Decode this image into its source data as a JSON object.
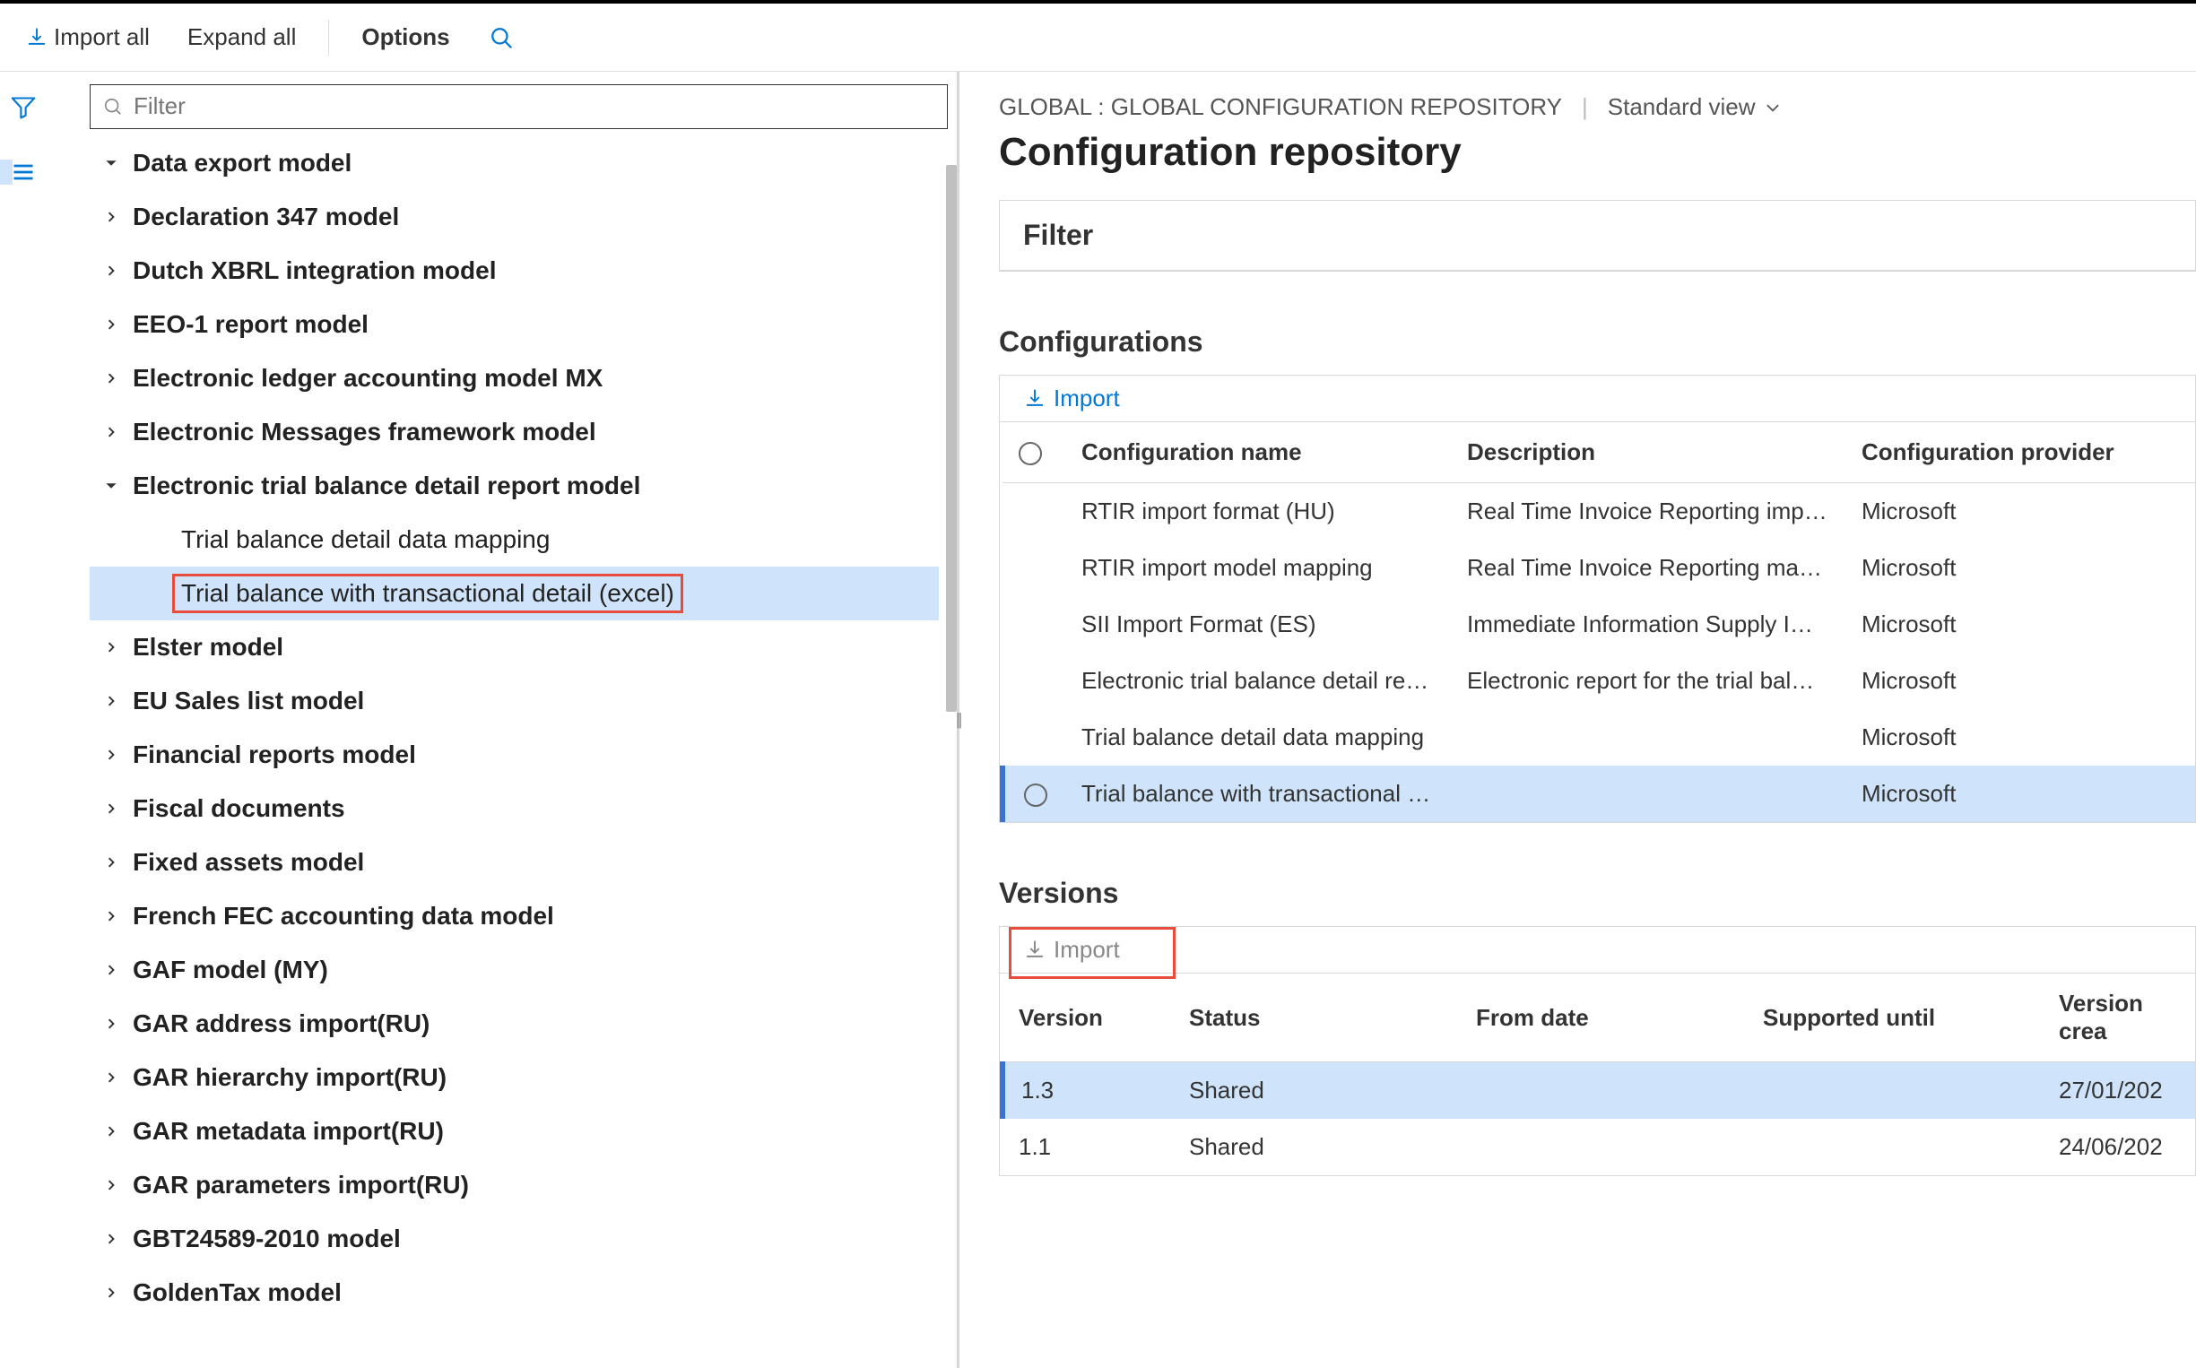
{
  "toolbar": {
    "import_all": "Import all",
    "expand_all": "Expand all",
    "options": "Options"
  },
  "left": {
    "filter_placeholder": "Filter",
    "tree": [
      {
        "label": "Data export model",
        "expanded": true,
        "depth": 1
      },
      {
        "label": "Declaration 347 model",
        "depth": 1
      },
      {
        "label": "Dutch XBRL integration model",
        "depth": 1
      },
      {
        "label": "EEO-1 report model",
        "depth": 1
      },
      {
        "label": "Electronic ledger accounting model MX",
        "depth": 1
      },
      {
        "label": "Electronic Messages framework model",
        "depth": 1
      },
      {
        "label": "Electronic trial balance detail report model",
        "expanded": true,
        "depth": 1
      },
      {
        "label": "Trial balance detail data mapping",
        "child": true,
        "depth": 2
      },
      {
        "label": "Trial balance with transactional detail (excel)",
        "child": true,
        "selected": true,
        "redbox": true,
        "depth": 2
      },
      {
        "label": "Elster model",
        "depth": 1
      },
      {
        "label": "EU Sales list model",
        "depth": 1
      },
      {
        "label": "Financial reports model",
        "depth": 1
      },
      {
        "label": "Fiscal documents",
        "depth": 1
      },
      {
        "label": "Fixed assets model",
        "depth": 1
      },
      {
        "label": "French FEC accounting data model",
        "depth": 1
      },
      {
        "label": "GAF model (MY)",
        "depth": 1
      },
      {
        "label": "GAR address import(RU)",
        "depth": 1
      },
      {
        "label": "GAR hierarchy import(RU)",
        "depth": 1
      },
      {
        "label": "GAR metadata import(RU)",
        "depth": 1
      },
      {
        "label": "GAR parameters import(RU)",
        "depth": 1
      },
      {
        "label": "GBT24589-2010 model",
        "depth": 1
      },
      {
        "label": "GoldenTax model",
        "depth": 1
      }
    ]
  },
  "right": {
    "breadcrumb": "GLOBAL : GLOBAL CONFIGURATION REPOSITORY",
    "view_label": "Standard view",
    "page_title": "Configuration repository",
    "filter_header": "Filter",
    "configurations": {
      "header": "Configurations",
      "import_label": "Import",
      "columns": {
        "name": "Configuration name",
        "desc": "Description",
        "provider": "Configuration provider"
      },
      "rows": [
        {
          "name": "RTIR import format (HU)",
          "desc": "Real Time Invoice Reporting imp…",
          "provider": "Microsoft"
        },
        {
          "name": "RTIR import model mapping",
          "desc": "Real Time Invoice Reporting ma…",
          "provider": "Microsoft"
        },
        {
          "name": "SII Import Format (ES)",
          "desc": "Immediate Information Supply I…",
          "provider": "Microsoft"
        },
        {
          "name": "Electronic trial balance detail re…",
          "desc": "Electronic report for the trial bal…",
          "provider": "Microsoft"
        },
        {
          "name": "Trial balance detail data mapping",
          "desc": "",
          "provider": "Microsoft"
        },
        {
          "name": "Trial balance with transactional …",
          "desc": "",
          "provider": "Microsoft",
          "selected": true
        }
      ]
    },
    "versions": {
      "header": "Versions",
      "import_label": "Import",
      "columns": {
        "version": "Version",
        "status": "Status",
        "from_date": "From date",
        "supported_until": "Supported until",
        "created": "Version crea"
      },
      "rows": [
        {
          "version": "1.3",
          "status": "Shared",
          "from_date": "",
          "supported_until": "",
          "created": "27/01/202",
          "selected": true
        },
        {
          "version": "1.1",
          "status": "Shared",
          "from_date": "",
          "supported_until": "",
          "created": "24/06/202"
        }
      ]
    }
  }
}
